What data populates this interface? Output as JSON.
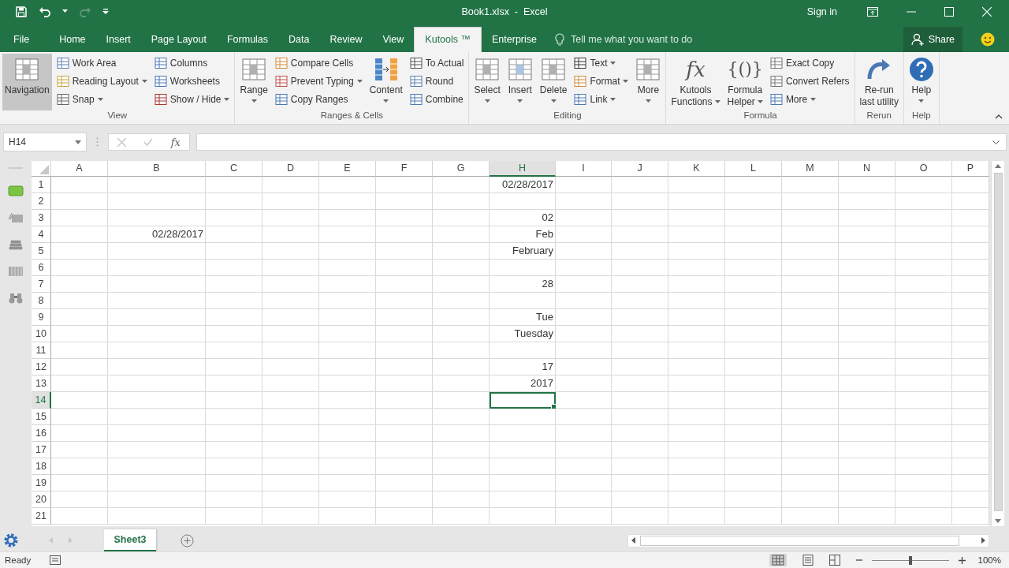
{
  "title_bar": {
    "title": "Book1.xlsx  -  Excel",
    "sign_in": "Sign in"
  },
  "tabs": [
    {
      "label": "File",
      "selected": false
    },
    {
      "label": "Home",
      "selected": false
    },
    {
      "label": "Insert",
      "selected": false
    },
    {
      "label": "Page Layout",
      "selected": false
    },
    {
      "label": "Formulas",
      "selected": false
    },
    {
      "label": "Data",
      "selected": false
    },
    {
      "label": "Review",
      "selected": false
    },
    {
      "label": "View",
      "selected": false
    },
    {
      "label": "Kutools ™",
      "selected": true
    },
    {
      "label": "Enterprise",
      "selected": false
    }
  ],
  "tell_me": {
    "placeholder": "Tell me what you want to do"
  },
  "share": "Share",
  "ribbon": [
    {
      "label": "View",
      "controls": [
        {
          "kind": "large",
          "lines": [
            "Navigation"
          ],
          "dropdown": false,
          "selected": true
        },
        {
          "kind": "stack",
          "items": [
            {
              "label": "Work Area",
              "dropdown": false
            },
            {
              "label": "Reading Layout",
              "dropdown": true
            },
            {
              "label": "Snap",
              "dropdown": true
            }
          ]
        },
        {
          "kind": "stack",
          "items": [
            {
              "label": "Columns",
              "dropdown": false
            },
            {
              "label": "Worksheets",
              "dropdown": false
            },
            {
              "label": "Show / Hide",
              "dropdown": true
            }
          ]
        }
      ]
    },
    {
      "label": "Ranges & Cells",
      "controls": [
        {
          "kind": "large",
          "lines": [
            "Range"
          ],
          "dropdown": true,
          "selected": false
        },
        {
          "kind": "stack",
          "items": [
            {
              "label": "Compare Cells",
              "dropdown": false
            },
            {
              "label": "Prevent Typing",
              "dropdown": true
            },
            {
              "label": "Copy Ranges",
              "dropdown": false
            }
          ]
        },
        {
          "kind": "large",
          "lines": [
            "Content"
          ],
          "dropdown": true,
          "selected": false
        },
        {
          "kind": "stack",
          "items": [
            {
              "label": "To Actual",
              "dropdown": false
            },
            {
              "label": "Round",
              "dropdown": false
            },
            {
              "label": "Combine",
              "dropdown": false
            }
          ]
        }
      ]
    },
    {
      "label": "Editing",
      "controls": [
        {
          "kind": "large",
          "lines": [
            "Select"
          ],
          "dropdown": true,
          "selected": false
        },
        {
          "kind": "large",
          "lines": [
            "Insert"
          ],
          "dropdown": true,
          "selected": false
        },
        {
          "kind": "large",
          "lines": [
            "Delete"
          ],
          "dropdown": true,
          "selected": false
        },
        {
          "kind": "stack",
          "items": [
            {
              "label": "Text",
              "dropdown": true
            },
            {
              "label": "Format",
              "dropdown": true
            },
            {
              "label": "Link",
              "dropdown": true
            }
          ]
        },
        {
          "kind": "large",
          "lines": [
            "More"
          ],
          "dropdown": true,
          "selected": false
        }
      ]
    },
    {
      "label": "Formula",
      "controls": [
        {
          "kind": "large",
          "icon_text": "fx",
          "lines": [
            "Kutools",
            "Functions"
          ],
          "dropdown": true,
          "selected": false
        },
        {
          "kind": "large",
          "icon_text": "{()}",
          "lines": [
            "Formula",
            "Helper"
          ],
          "dropdown": true,
          "selected": false
        },
        {
          "kind": "stack",
          "items": [
            {
              "label": "Exact Copy",
              "dropdown": false
            },
            {
              "label": "Convert Refers",
              "dropdown": false
            },
            {
              "label": "More",
              "dropdown": true
            }
          ]
        }
      ]
    },
    {
      "label": "Rerun",
      "controls": [
        {
          "kind": "large",
          "lines": [
            "Re-run",
            "last utility"
          ],
          "dropdown": false,
          "selected": false
        }
      ]
    },
    {
      "label": "Help",
      "controls": [
        {
          "kind": "large",
          "lines": [
            "Help"
          ],
          "dropdown": true,
          "selected": false
        }
      ]
    }
  ],
  "formula_bar": {
    "name_box": "H14",
    "function_label": "fx"
  },
  "sheet": {
    "columns": [
      {
        "label": "A",
        "selected": false
      },
      {
        "label": "B",
        "selected": false
      },
      {
        "label": "C",
        "selected": false
      },
      {
        "label": "D",
        "selected": false
      },
      {
        "label": "E",
        "selected": false
      },
      {
        "label": "F",
        "selected": false
      },
      {
        "label": "G",
        "selected": false
      },
      {
        "label": "H",
        "selected": true
      },
      {
        "label": "I",
        "selected": false
      },
      {
        "label": "J",
        "selected": false
      },
      {
        "label": "K",
        "selected": false
      },
      {
        "label": "L",
        "selected": false
      },
      {
        "label": "M",
        "selected": false
      },
      {
        "label": "N",
        "selected": false
      },
      {
        "label": "O",
        "selected": false
      },
      {
        "label": "P",
        "selected": false
      }
    ],
    "rows": [
      {
        "label": "1",
        "selected": false,
        "cells": [
          null,
          null,
          null,
          null,
          null,
          null,
          null,
          "02/28/2017",
          null,
          null,
          null,
          null,
          null,
          null,
          null,
          null
        ]
      },
      {
        "label": "2",
        "selected": false,
        "cells": [
          null,
          null,
          null,
          null,
          null,
          null,
          null,
          null,
          null,
          null,
          null,
          null,
          null,
          null,
          null,
          null
        ]
      },
      {
        "label": "3",
        "selected": false,
        "cells": [
          null,
          null,
          null,
          null,
          null,
          null,
          null,
          "02",
          null,
          null,
          null,
          null,
          null,
          null,
          null,
          null
        ]
      },
      {
        "label": "4",
        "selected": false,
        "cells": [
          null,
          "02/28/2017",
          null,
          null,
          null,
          null,
          null,
          "Feb",
          null,
          null,
          null,
          null,
          null,
          null,
          null,
          null
        ]
      },
      {
        "label": "5",
        "selected": false,
        "cells": [
          null,
          null,
          null,
          null,
          null,
          null,
          null,
          "February",
          null,
          null,
          null,
          null,
          null,
          null,
          null,
          null
        ]
      },
      {
        "label": "6",
        "selected": false,
        "cells": [
          null,
          null,
          null,
          null,
          null,
          null,
          null,
          null,
          null,
          null,
          null,
          null,
          null,
          null,
          null,
          null
        ]
      },
      {
        "label": "7",
        "selected": false,
        "cells": [
          null,
          null,
          null,
          null,
          null,
          null,
          null,
          "28",
          null,
          null,
          null,
          null,
          null,
          null,
          null,
          null
        ]
      },
      {
        "label": "8",
        "selected": false,
        "cells": [
          null,
          null,
          null,
          null,
          null,
          null,
          null,
          null,
          null,
          null,
          null,
          null,
          null,
          null,
          null,
          null
        ]
      },
      {
        "label": "9",
        "selected": false,
        "cells": [
          null,
          null,
          null,
          null,
          null,
          null,
          null,
          "Tue",
          null,
          null,
          null,
          null,
          null,
          null,
          null,
          null
        ]
      },
      {
        "label": "10",
        "selected": false,
        "cells": [
          null,
          null,
          null,
          null,
          null,
          null,
          null,
          "Tuesday",
          null,
          null,
          null,
          null,
          null,
          null,
          null,
          null
        ]
      },
      {
        "label": "11",
        "selected": false,
        "cells": [
          null,
          null,
          null,
          null,
          null,
          null,
          null,
          null,
          null,
          null,
          null,
          null,
          null,
          null,
          null,
          null
        ]
      },
      {
        "label": "12",
        "selected": false,
        "cells": [
          null,
          null,
          null,
          null,
          null,
          null,
          null,
          "17",
          null,
          null,
          null,
          null,
          null,
          null,
          null,
          null
        ]
      },
      {
        "label": "13",
        "selected": false,
        "cells": [
          null,
          null,
          null,
          null,
          null,
          null,
          null,
          "2017",
          null,
          null,
          null,
          null,
          null,
          null,
          null,
          null
        ]
      },
      {
        "label": "14",
        "selected": true,
        "cells": [
          null,
          null,
          null,
          null,
          null,
          null,
          null,
          null,
          null,
          null,
          null,
          null,
          null,
          null,
          null,
          null
        ]
      },
      {
        "label": "15",
        "selected": false,
        "cells": [
          null,
          null,
          null,
          null,
          null,
          null,
          null,
          null,
          null,
          null,
          null,
          null,
          null,
          null,
          null,
          null
        ]
      },
      {
        "label": "16",
        "selected": false,
        "cells": [
          null,
          null,
          null,
          null,
          null,
          null,
          null,
          null,
          null,
          null,
          null,
          null,
          null,
          null,
          null,
          null
        ]
      },
      {
        "label": "17",
        "selected": false,
        "cells": [
          null,
          null,
          null,
          null,
          null,
          null,
          null,
          null,
          null,
          null,
          null,
          null,
          null,
          null,
          null,
          null
        ]
      },
      {
        "label": "18",
        "selected": false,
        "cells": [
          null,
          null,
          null,
          null,
          null,
          null,
          null,
          null,
          null,
          null,
          null,
          null,
          null,
          null,
          null,
          null
        ]
      },
      {
        "label": "19",
        "selected": false,
        "cells": [
          null,
          null,
          null,
          null,
          null,
          null,
          null,
          null,
          null,
          null,
          null,
          null,
          null,
          null,
          null,
          null
        ]
      },
      {
        "label": "20",
        "selected": false,
        "cells": [
          null,
          null,
          null,
          null,
          null,
          null,
          null,
          null,
          null,
          null,
          null,
          null,
          null,
          null,
          null,
          null
        ]
      },
      {
        "label": "21",
        "selected": false,
        "cells": [
          null,
          null,
          null,
          null,
          null,
          null,
          null,
          null,
          null,
          null,
          null,
          null,
          null,
          null,
          null,
          null
        ]
      }
    ]
  },
  "sheet_tabs": [
    {
      "label": "Sheet3",
      "selected": true
    }
  ],
  "status_bar": {
    "status": "Ready",
    "zoom": "100%",
    "zoom_slider": {
      "level": 0.5
    }
  }
}
